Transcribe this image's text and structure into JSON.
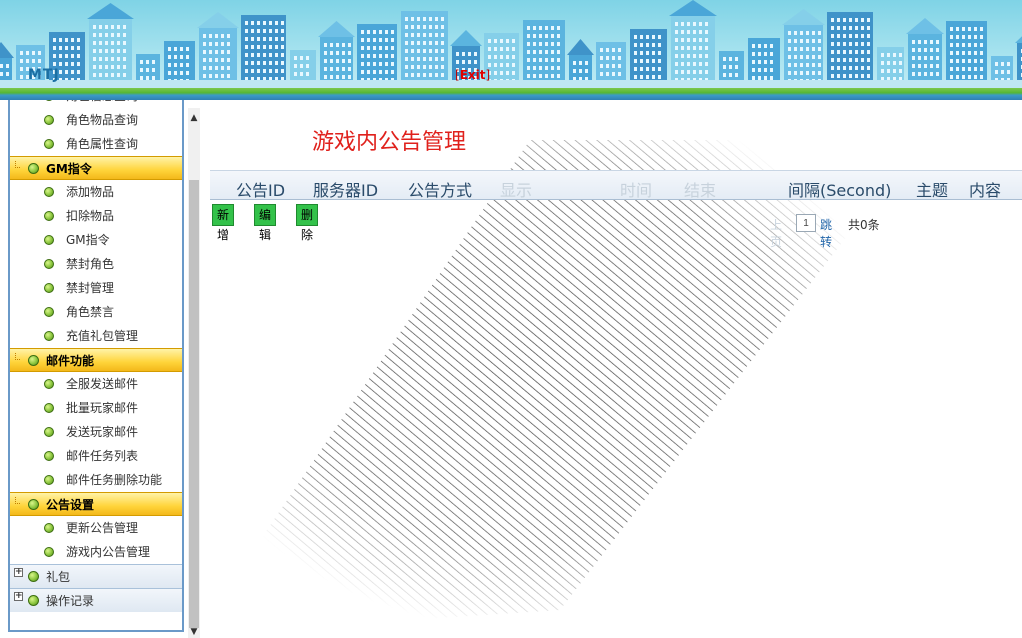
{
  "header": {
    "brand": "MTJ",
    "exit_open": "[",
    "exit_label": "Exit",
    "exit_close": "]"
  },
  "sidebar": {
    "partial_item": "角色信息查询",
    "top_items": [
      "角色物品查询",
      "角色属性查询"
    ],
    "groups": [
      {
        "title": "GM指令",
        "items": [
          "添加物品",
          "扣除物品",
          "GM指令",
          "禁封角色",
          "禁封管理",
          "角色禁言",
          "充值礼包管理"
        ]
      },
      {
        "title": "邮件功能",
        "items": [
          "全服发送邮件",
          "批量玩家邮件",
          "发送玩家邮件",
          "邮件任务列表",
          "邮件任务删除功能"
        ]
      },
      {
        "title": "公告设置",
        "items": [
          "更新公告管理",
          "游戏内公告管理"
        ]
      }
    ],
    "collapsed_groups": [
      "礼包",
      "操作记录"
    ],
    "plus_symbol": "+"
  },
  "scroll": {
    "up_arrow": "▲",
    "down_arrow": "▼"
  },
  "main": {
    "title": "游戏内公告管理",
    "columns": [
      {
        "label": "公告ID",
        "faded": false
      },
      {
        "label": "服务器ID",
        "faded": false
      },
      {
        "label": "公告方式",
        "faded": false
      },
      {
        "label": "显示",
        "faded": true
      },
      {
        "label": "时间",
        "faded": true
      },
      {
        "label": "结束",
        "faded": true
      },
      {
        "label": "间隔(Second)",
        "faded": false
      },
      {
        "label": "主题",
        "faded": false
      },
      {
        "label": "内容",
        "faded": false
      }
    ],
    "buttons": {
      "add": "新增",
      "edit": "编辑",
      "delete": "删除"
    },
    "pager": {
      "prev": "上页",
      "page_value": "1",
      "jump": "跳转",
      "total": "共0条"
    }
  },
  "colors": {
    "title_red": "#e0211c",
    "button_green": "#33c24a",
    "group_yellow": "#ffd43a",
    "sidebar_border": "#6a99c8"
  }
}
